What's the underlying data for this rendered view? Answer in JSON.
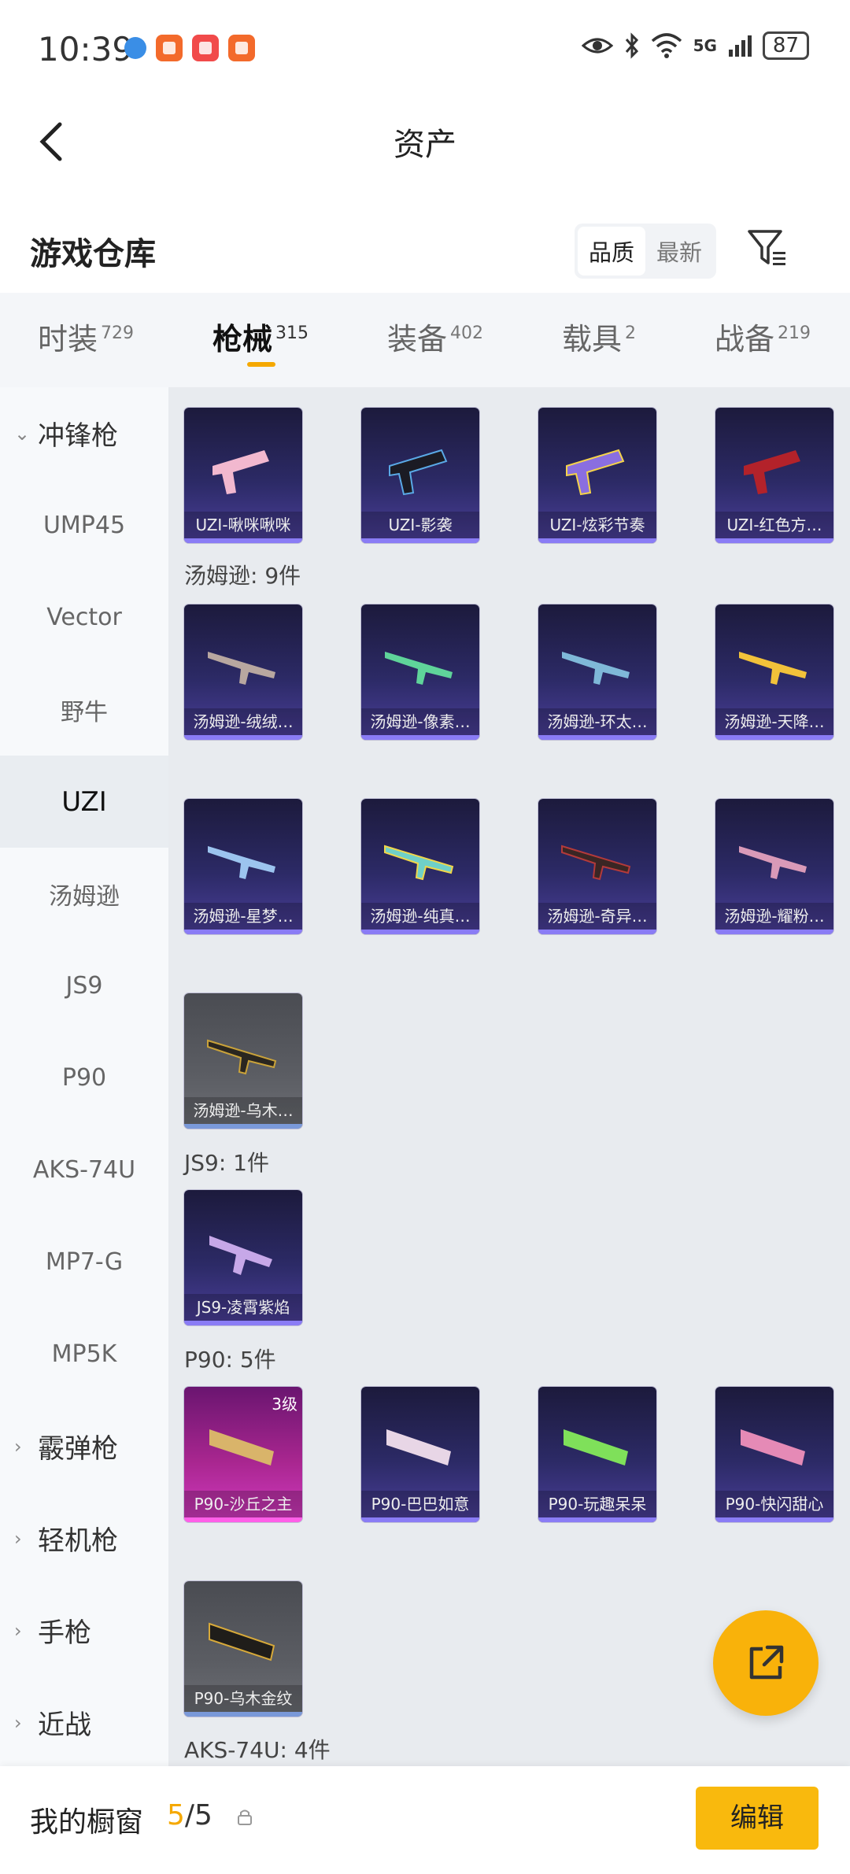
{
  "status_bar": {
    "time": "10:39",
    "network": "5G",
    "battery": "87"
  },
  "header": {
    "title": "资产"
  },
  "warehouse": {
    "title": "游戏仓库",
    "sort_options": [
      "品质",
      "最新"
    ]
  },
  "tabs": [
    {
      "label": "时装",
      "count": "729"
    },
    {
      "label": "枪械",
      "count": "315"
    },
    {
      "label": "装备",
      "count": "402"
    },
    {
      "label": "载具",
      "count": "2"
    },
    {
      "label": "战备",
      "count": "219"
    }
  ],
  "sidebar": [
    {
      "label": "冲锋枪",
      "type": "group",
      "expanded": true
    },
    {
      "label": "UMP45"
    },
    {
      "label": "Vector"
    },
    {
      "label": "野牛"
    },
    {
      "label": "UZI",
      "active": true
    },
    {
      "label": "汤姆逊"
    },
    {
      "label": "JS9"
    },
    {
      "label": "P90"
    },
    {
      "label": "AKS-74U"
    },
    {
      "label": "MP7-G"
    },
    {
      "label": "MP5K"
    },
    {
      "label": "霰弹枪",
      "type": "group"
    },
    {
      "label": "轻机枪",
      "type": "group"
    },
    {
      "label": "手枪",
      "type": "group"
    },
    {
      "label": "近战",
      "type": "group"
    }
  ],
  "sections": {
    "uzi": {
      "cards": [
        "UZI-啾咪啾咪",
        "UZI-影袭",
        "UZI-炫彩节奏",
        "UZI-红色方…"
      ]
    },
    "thompson": {
      "label": "汤姆逊: 9件",
      "cards": [
        "汤姆逊-绒绒…",
        "汤姆逊-像素…",
        "汤姆逊-环太…",
        "汤姆逊-天降…",
        "汤姆逊-星梦…",
        "汤姆逊-纯真…",
        "汤姆逊-奇异…",
        "汤姆逊-耀粉…",
        "汤姆逊-乌木…"
      ]
    },
    "js9": {
      "label": "JS9: 1件",
      "cards": [
        "JS9-凌霄紫焰"
      ]
    },
    "p90": {
      "label": "P90: 5件",
      "cards": [
        "P90-沙丘之主",
        "P90-巴巴如意",
        "P90-玩趣呆呆",
        "P90-快闪甜心",
        "P90-乌木金纹"
      ],
      "level_badge": "3级"
    },
    "aks": {
      "label": "AKS-74U: 4件"
    }
  },
  "bottom_bar": {
    "showcase_label": "我的橱窗",
    "current": "5",
    "separator": "/",
    "total": "5",
    "edit_label": "编辑"
  },
  "colors": {
    "accent": "#f9b90d",
    "card_purple": "#2c2a66",
    "card_grey": "#5b5d63",
    "card_pink": "#a8268f"
  },
  "icons": {
    "back": "chevron-left-icon",
    "filter": "filter-icon",
    "share": "share-external-icon",
    "lock": "lock-icon"
  }
}
